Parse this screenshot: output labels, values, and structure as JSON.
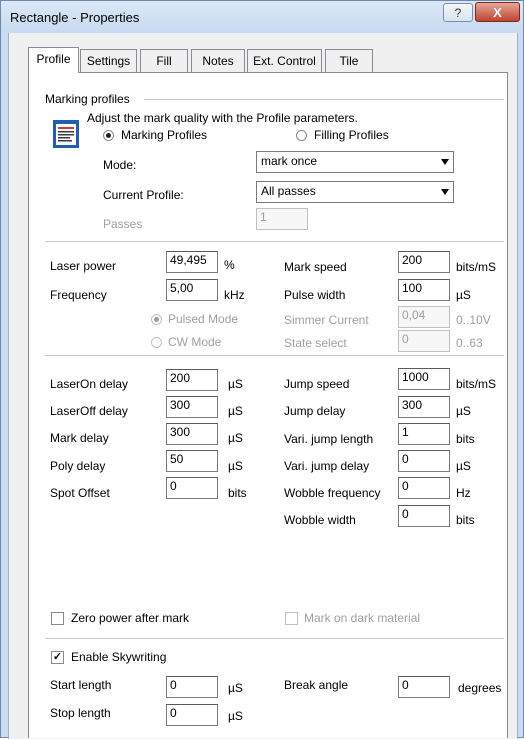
{
  "window": {
    "title": "Rectangle - Properties",
    "help_glyph": "?",
    "close_glyph": "X"
  },
  "tabs": [
    {
      "label": "Profile",
      "active": true
    },
    {
      "label": "Settings"
    },
    {
      "label": "Fill"
    },
    {
      "label": "Notes"
    },
    {
      "label": "Ext. Control"
    },
    {
      "label": "Tile"
    }
  ],
  "marking_profiles": {
    "group_label": "Marking profiles",
    "description": "Adjust the mark quality with the Profile parameters.",
    "radio_marking": "Marking Profiles",
    "radio_filling": "Filling Profiles",
    "selected": "Marking Profiles",
    "mode_label": "Mode:",
    "mode_value": "mark once",
    "current_profile_label": "Current Profile:",
    "current_profile_value": "All passes",
    "passes_label": "Passes",
    "passes_value": "1"
  },
  "laser": {
    "power_label": "Laser power",
    "power_value": "49,495",
    "power_unit": "%",
    "frequency_label": "Frequency",
    "frequency_value": "5,00",
    "frequency_unit": "kHz",
    "mark_speed_label": "Mark speed",
    "mark_speed_value": "200",
    "mark_speed_unit": "bits/mS",
    "pulse_width_label": "Pulse width",
    "pulse_width_value": "100",
    "pulse_width_unit": "µS",
    "pulsed_mode_label": "Pulsed Mode",
    "cw_mode_label": "CW Mode",
    "simmer_label": "Simmer Current",
    "simmer_value": "0,04",
    "simmer_range": "0..10V",
    "state_label": "State select",
    "state_value": "0",
    "state_range": "0..63"
  },
  "delays": {
    "left": [
      {
        "label": "LaserOn delay",
        "value": "200",
        "unit": "µS"
      },
      {
        "label": "LaserOff delay",
        "value": "300",
        "unit": "µS"
      },
      {
        "label": "Mark delay",
        "value": "300",
        "unit": "µS"
      },
      {
        "label": "Poly delay",
        "value": "50",
        "unit": "µS"
      },
      {
        "label": "Spot Offset",
        "value": "0",
        "unit": "bits"
      }
    ],
    "right": [
      {
        "label": "Jump speed",
        "value": "1000",
        "unit": "bits/mS"
      },
      {
        "label": "Jump delay",
        "value": "300",
        "unit": "µS"
      },
      {
        "label": "Vari. jump length",
        "value": "1",
        "unit": "bits"
      },
      {
        "label": "Vari. jump delay",
        "value": "0",
        "unit": "µS"
      },
      {
        "label": "Wobble frequency",
        "value": "0",
        "unit": "Hz"
      },
      {
        "label": "Wobble width",
        "value": "0",
        "unit": "bits"
      }
    ]
  },
  "options": {
    "zero_power_label": "Zero power after mark",
    "zero_power_checked": false,
    "mark_dark_label": "Mark on dark material",
    "mark_dark_checked": false
  },
  "skywriting": {
    "enable_label": "Enable Skywriting",
    "enable_checked": true,
    "check_glyph": "✓",
    "start_label": "Start length",
    "start_value": "0",
    "start_unit": "µS",
    "stop_label": "Stop length",
    "stop_value": "0",
    "stop_unit": "µS",
    "break_label": "Break angle",
    "break_value": "0",
    "break_unit": "degrees"
  }
}
